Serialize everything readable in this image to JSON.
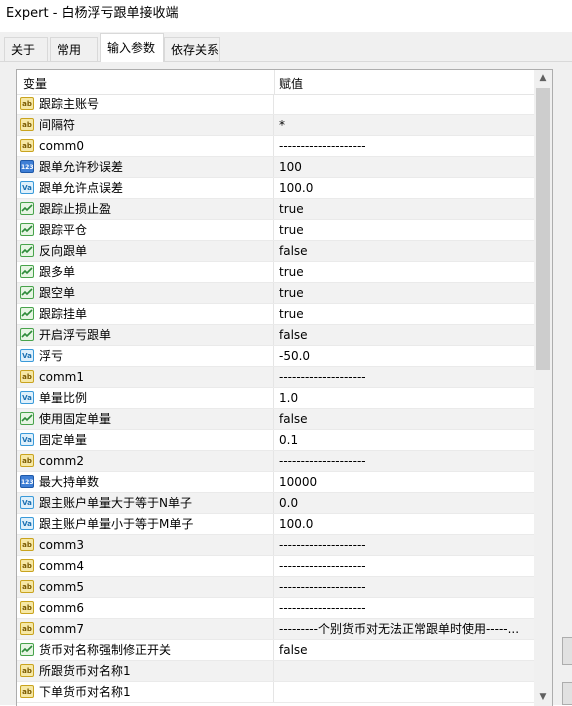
{
  "window": {
    "title": "Expert - 白杨浮亏跟单接收端"
  },
  "tabs": [
    {
      "label": "关于"
    },
    {
      "label": "常用"
    },
    {
      "label": "输入参数"
    },
    {
      "label": "依存关系"
    }
  ],
  "active_tab": "输入参数",
  "grid": {
    "headers": {
      "variable": "变量",
      "value": "赋值"
    },
    "rows": [
      {
        "type": "ab",
        "icon": "string-icon",
        "name": "跟踪主账号",
        "value": ""
      },
      {
        "type": "ab",
        "icon": "string-icon",
        "name": "间隔符",
        "value": "*"
      },
      {
        "type": "ab",
        "icon": "string-icon",
        "name": "comm0",
        "value": "--------------------"
      },
      {
        "type": "123",
        "icon": "integer-icon",
        "name": "跟单允许秒误差",
        "value": "100"
      },
      {
        "type": "va",
        "icon": "double-icon",
        "name": "跟单允许点误差",
        "value": "100.0"
      },
      {
        "type": "bool",
        "icon": "bool-icon",
        "name": "跟踪止损止盈",
        "value": "true"
      },
      {
        "type": "bool",
        "icon": "bool-icon",
        "name": "跟踪平仓",
        "value": "true"
      },
      {
        "type": "bool",
        "icon": "bool-icon",
        "name": "反向跟单",
        "value": "false"
      },
      {
        "type": "bool",
        "icon": "bool-icon",
        "name": "跟多单",
        "value": "true"
      },
      {
        "type": "bool",
        "icon": "bool-icon",
        "name": "跟空单",
        "value": "true"
      },
      {
        "type": "bool",
        "icon": "bool-icon",
        "name": "跟踪挂单",
        "value": "true"
      },
      {
        "type": "bool",
        "icon": "bool-icon",
        "name": "开启浮亏跟单",
        "value": "false"
      },
      {
        "type": "va",
        "icon": "double-icon",
        "name": "浮亏",
        "value": "-50.0"
      },
      {
        "type": "ab",
        "icon": "string-icon",
        "name": "comm1",
        "value": "--------------------"
      },
      {
        "type": "va",
        "icon": "double-icon",
        "name": "单量比例",
        "value": "1.0"
      },
      {
        "type": "bool",
        "icon": "bool-icon",
        "name": "使用固定单量",
        "value": "false"
      },
      {
        "type": "va",
        "icon": "double-icon",
        "name": "固定单量",
        "value": "0.1"
      },
      {
        "type": "ab",
        "icon": "string-icon",
        "name": "comm2",
        "value": "--------------------"
      },
      {
        "type": "123",
        "icon": "integer-icon",
        "name": "最大持单数",
        "value": "10000"
      },
      {
        "type": "va",
        "icon": "double-icon",
        "name": "跟主账户单量大于等于N单子",
        "value": "0.0"
      },
      {
        "type": "va",
        "icon": "double-icon",
        "name": "跟主账户单量小于等于M单子",
        "value": "100.0"
      },
      {
        "type": "ab",
        "icon": "string-icon",
        "name": "comm3",
        "value": "--------------------"
      },
      {
        "type": "ab",
        "icon": "string-icon",
        "name": "comm4",
        "value": "--------------------"
      },
      {
        "type": "ab",
        "icon": "string-icon",
        "name": "comm5",
        "value": "--------------------"
      },
      {
        "type": "ab",
        "icon": "string-icon",
        "name": "comm6",
        "value": "--------------------"
      },
      {
        "type": "ab",
        "icon": "string-icon",
        "name": "comm7",
        "value": "---------个别货币对无法正常跟单时使用-----..."
      },
      {
        "type": "bool",
        "icon": "bool-icon",
        "name": "货币对名称强制修正开关",
        "value": "false"
      },
      {
        "type": "ab",
        "icon": "string-icon",
        "name": "所跟货币对名称1",
        "value": ""
      },
      {
        "type": "ab",
        "icon": "string-icon",
        "name": "下单货币对名称1",
        "value": ""
      }
    ]
  },
  "icon_glyphs": {
    "ab": "ab",
    "123": "123",
    "va": "Va",
    "bool": ""
  },
  "colors": {
    "bool_check": "#2e8b3a",
    "row_alt": "#f2f2f2"
  }
}
